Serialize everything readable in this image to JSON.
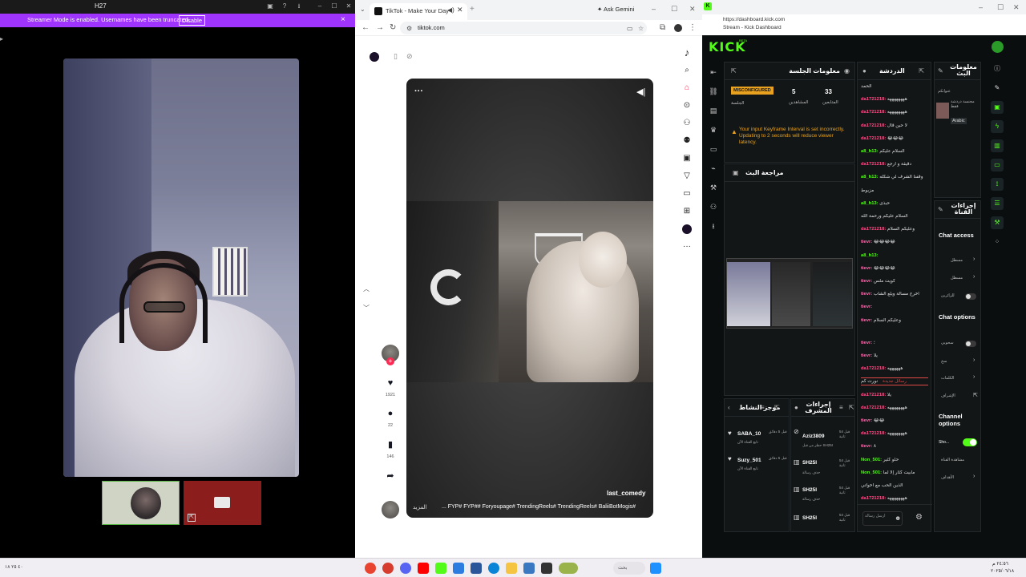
{
  "left_app": {
    "title": "H27",
    "banner_text": "Streamer Mode is enabled. Usernames have been truncated.",
    "banner_button": "Disable",
    "banner_close": "×"
  },
  "browser": {
    "tab_title": "TikTok - Make Your Day",
    "new_tab": "+",
    "gemini_label": "Ask Gemini",
    "url": "tiktok.com",
    "min": "–",
    "max": "☐",
    "close": "✕"
  },
  "tiktok": {
    "author": "last_comedy",
    "caption": "... FYP# FYP## Foryoupage# TrendingReels# TrendingReels# BaliiBotMogis#",
    "more_link": "المزيد",
    "likes": "1921",
    "comments": "22",
    "saves": "146",
    "icons": {
      "like": "heart-icon",
      "comment": "comment-icon",
      "save": "bookmark-icon",
      "share": "share-icon"
    }
  },
  "kick": {
    "url": "https://dashboard.kick.com",
    "page_title": "Stream - Kick Dashboard",
    "logo": "KICK",
    "logo_badge": "BETA",
    "session": {
      "title": "معلومات الجلسة",
      "status": "MISCONFIGURED",
      "status_label": "الجلسة",
      "viewers": "5",
      "viewers_label": "المشاهدين",
      "followers": "33",
      "followers_label": "المتابعين",
      "warning": "Your input Keyframe Interval is set incorrectly. Updating to 2 seconds will reduce viewer latency."
    },
    "preview_title": "مراجعة البث",
    "chat_title": "الدردشة",
    "chat_messages": [
      {
        "user": "",
        "text": "الحمد",
        "color": "red"
      },
      {
        "user": "da1721218:",
        "text": "ههههههههه",
        "color": "red"
      },
      {
        "user": "da1721218:",
        "text": "ههههههههه",
        "color": "red"
      },
      {
        "user": "da1721218:",
        "text": "لا حين قال",
        "color": "red"
      },
      {
        "user": "da1721218:",
        "text": "😂😂😂",
        "color": "red"
      },
      {
        "user": "a8_h13:",
        "text": "السلام عليكم",
        "color": "green"
      },
      {
        "user": "da1721218:",
        "text": "دقيقة و ارجع",
        "color": "red"
      },
      {
        "user": "a8_h13:",
        "text": "وقفنا الشرف لي شكله",
        "color": "green"
      },
      {
        "user": "",
        "text": "مزبوط",
        "color": "red"
      },
      {
        "user": "a8_h13:",
        "text": "حبذى",
        "color": "green"
      },
      {
        "user": "",
        "text": "السلام عليكم ورحمة الله",
        "color": "red"
      },
      {
        "user": "da1721218:",
        "text": "وعليكم السلام",
        "color": "red"
      },
      {
        "user": "tievr:",
        "text": "😂😂😂😂",
        "color": "pink"
      },
      {
        "user": "a8_h13:",
        "text": "",
        "color": "green"
      },
      {
        "user": "tievr:",
        "text": "😂😂😂😂",
        "color": "pink"
      },
      {
        "user": "tievr:",
        "text": "كويت ملس",
        "color": "pink"
      },
      {
        "user": "tievr:",
        "text": "اخرج مسالة ويلع الشاب",
        "color": "pink"
      },
      {
        "user": "tievr:",
        "text": "",
        "color": "pink"
      },
      {
        "user": "tievr:",
        "text": "وعليكم السلام",
        "color": "pink"
      },
      {
        "user": "tievr:",
        "text": "؛",
        "color": "pink"
      },
      {
        "user": "tievr:",
        "text": "يلا",
        "color": "pink"
      },
      {
        "user": "da1721218:",
        "text": "ههههههه",
        "color": "red"
      },
      {
        "user": "",
        "text": "نورت كم",
        "color": "red"
      },
      {
        "user": "da1721218:",
        "text": "يلا",
        "color": "red"
      },
      {
        "user": "da1721218:",
        "text": "ههههههههه",
        "color": "red"
      },
      {
        "user": "tievr:",
        "text": "😂😂",
        "color": "pink"
      },
      {
        "user": "da1721218:",
        "text": "ههههههههه",
        "color": "red"
      },
      {
        "user": "tievr:",
        "text": "٨",
        "color": "pink"
      },
      {
        "user": "Non_501:",
        "text": "حلو كثير",
        "color": "green"
      },
      {
        "user": "Non_501:",
        "text": "مابيت كثار إلا لما",
        "color": "green"
      },
      {
        "user": "",
        "text": "الذين الحب مع اخواتي",
        "color": "green"
      },
      {
        "user": "da1721218:",
        "text": "ههههههههه",
        "color": "red"
      }
    ],
    "new_messages": "رسائل جديدة",
    "chat_placeholder": "ارسل رسالة",
    "recent_events": {
      "title": "موجز النشاط",
      "items": [
        {
          "name": "SABA_10",
          "sub": "تابع القناة الآن",
          "time": "قبل 5 دقائق"
        },
        {
          "name": "Suzy_501",
          "sub": "تابع القناة الآن",
          "time": "قبل 5 دقائق"
        }
      ]
    },
    "mod_actions": {
      "title": "إجراءات المشرف",
      "items": [
        {
          "name": "Aziz3809",
          "sub": "حظر من قبل SH25I",
          "time": "قبل 54 ثانية"
        },
        {
          "name": "SH25I",
          "sub": "حذف رسالة",
          "time": "قبل 54 ثانية"
        },
        {
          "name": "SH25I",
          "sub": "حذف رسالة",
          "time": "قبل 54 ثانية"
        },
        {
          "name": "SH25I",
          "sub": "حذف رسالة",
          "time": "قبل 54 ثانية"
        }
      ]
    },
    "stream_info": {
      "title": "معلومات البث",
      "label": "عنوانكم",
      "category": "مجنسة دردشة فقط",
      "language": "Arabic"
    },
    "quick_actions": {
      "title": "إجراءات القناة",
      "chat_access": "Chat access",
      "chat_access_items": [
        "مسطل",
        "مسطل",
        "للزائرين"
      ],
      "chat_options": "Chat options",
      "chat_options_items": [
        "سحوبي",
        "سخ",
        "الكلمات",
        "الإشراف"
      ],
      "channel_options": "Channel options",
      "channel_options_items": [
        "Sho...",
        "مشاهدة القناة",
        "الأهداف"
      ]
    }
  },
  "taskbar": {
    "left_text": "٤٠ ٢٥ ١٨",
    "search": "بحث",
    "time": "٢٤:٥٦ م",
    "date": "٢٠٢٥/٠٦/١٨"
  }
}
